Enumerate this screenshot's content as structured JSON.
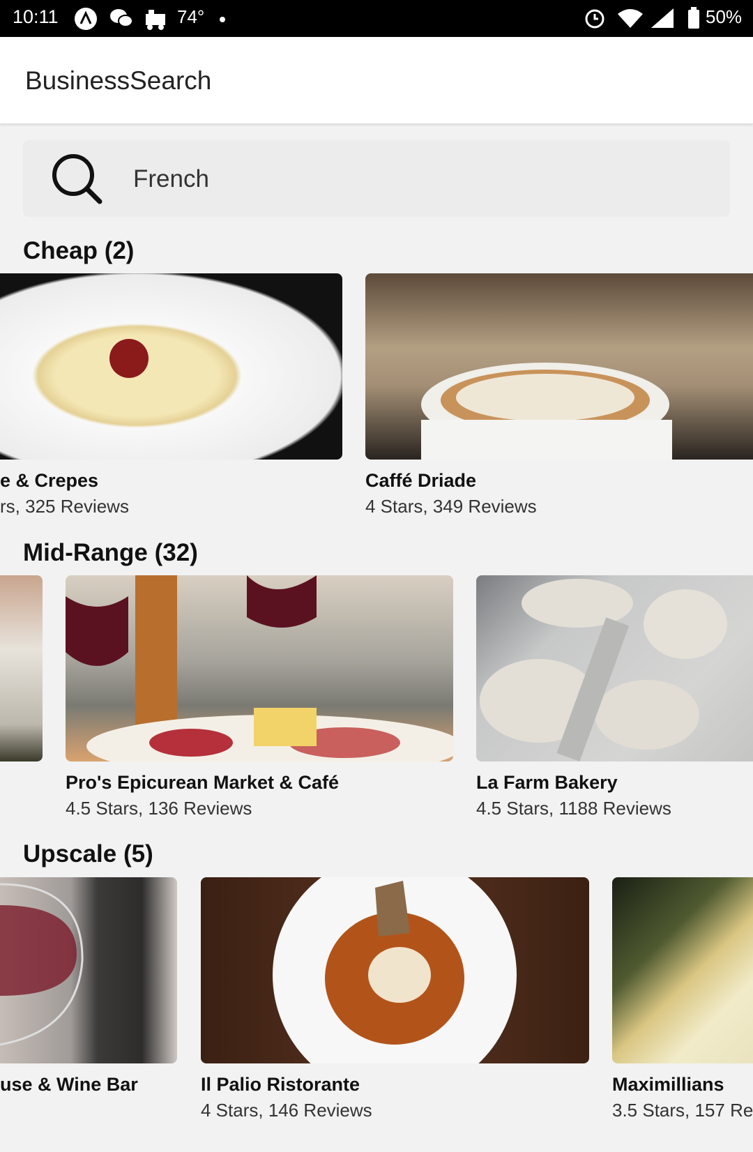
{
  "status_bar": {
    "time": "10:11",
    "temperature": "74°",
    "battery": "50%",
    "icons": [
      "nav-icon",
      "wechat-icon",
      "train-icon",
      "dot-icon",
      "alarm-icon",
      "wifi-icon",
      "signal-icon",
      "battery-icon"
    ]
  },
  "app": {
    "title": "BusinessSearch"
  },
  "search": {
    "value": "French",
    "icon": "search-icon"
  },
  "sections": [
    {
      "title": "Cheap (2)",
      "cards": [
        {
          "name": "e & Crepes",
          "meta": "rs, 325 Reviews"
        },
        {
          "name": "Caffé Driade",
          "meta": "4 Stars, 349 Reviews"
        }
      ]
    },
    {
      "title": "Mid-Range (32)",
      "cards": [
        {
          "name": "",
          "meta": ""
        },
        {
          "name": "Pro's Epicurean Market & Café",
          "meta": "4.5 Stars, 136 Reviews"
        },
        {
          "name": "La Farm Bakery",
          "meta": "4.5 Stars, 1188 Reviews"
        }
      ]
    },
    {
      "title": "Upscale (5)",
      "cards": [
        {
          "name": "use & Wine Bar",
          "meta": ""
        },
        {
          "name": "Il Palio Ristorante",
          "meta": "4 Stars, 146 Reviews"
        },
        {
          "name": "Maximillians",
          "meta": "3.5 Stars, 157 Re"
        }
      ]
    }
  ]
}
